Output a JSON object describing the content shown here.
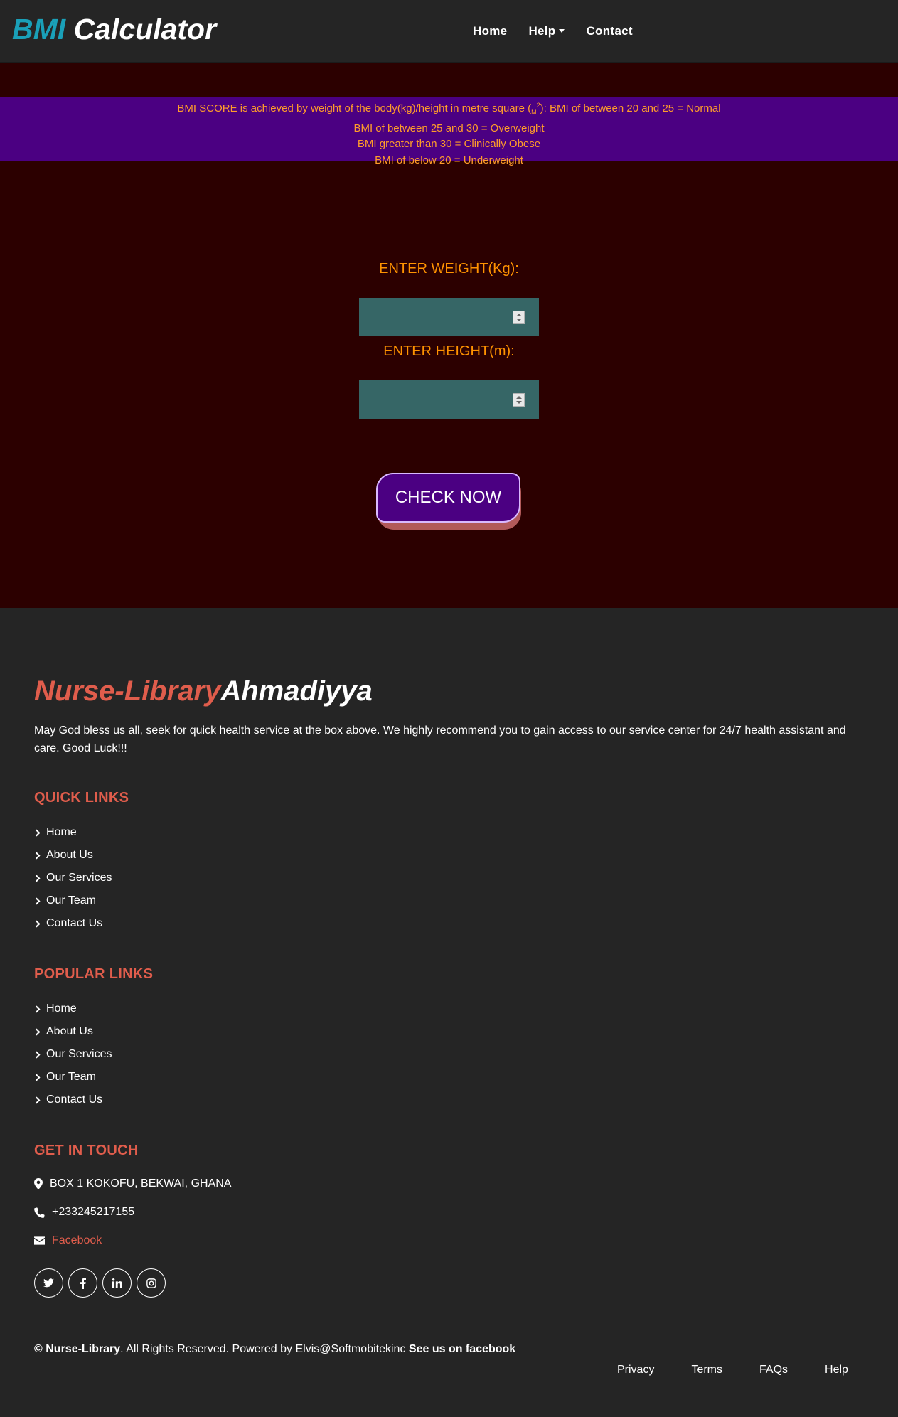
{
  "nav": {
    "brand_part1": "BMI",
    "brand_part2": "Calculator",
    "links": [
      {
        "label": "Home"
      },
      {
        "label": "Help"
      },
      {
        "label": "Contact"
      }
    ]
  },
  "info": {
    "line1_a": "BMI SCORE is achieved by weight of the body(kg)/height in metre square (",
    "line1_m": "M",
    "line1_exp": "2",
    "line1_b": "): BMI of between 20 and 25 = Normal",
    "line2": "BMI of between 25 and 30 = Overweight",
    "line3": "BMI greater than 30 = Clinically Obese",
    "line4": "BMI of below 20 = Underweight"
  },
  "form": {
    "weight_label": "ENTER WEIGHT(Kg):",
    "weight_value": "",
    "height_label": "ENTER HEIGHT(m):",
    "height_value": "",
    "submit_label": "CHECK NOW"
  },
  "footer": {
    "brand_part1": "Nurse-Library",
    "brand_part2": "Ahmadiyya",
    "description": "May God bless us all, seek for quick health service at the box above. We highly recommend you to gain access to our service center for 24/7 health assistant and care. Good Luck!!!",
    "quick_links_title": "QUICK LINKS",
    "quick_links": [
      "Home",
      "About Us",
      "Our Services",
      "Our Team",
      "Contact Us"
    ],
    "popular_links_title": "POPULAR LINKS",
    "popular_links": [
      "Home",
      "About Us",
      "Our Services",
      "Our Team",
      "Contact Us"
    ],
    "touch_title": "GET IN TOUCH",
    "address": "BOX 1 KOKOFU, BEKWAI, GHANA",
    "phone": "+233245217155",
    "email_link": "Facebook",
    "social": [
      {
        "icon": "twitter-icon",
        "glyph": "🐦"
      },
      {
        "icon": "facebook-icon",
        "glyph": "f"
      },
      {
        "icon": "linkedin-icon",
        "glyph": "in"
      },
      {
        "icon": "instagram-icon",
        "glyph": "◎"
      }
    ],
    "copyright_symbol_name": "© Nurse-Library",
    "copyright_text": ". All Rights Reserved. Powered by Elvis@Softmobitekinc ",
    "copyright_link": "See us on facebook",
    "bottom_links": [
      "Privacy",
      "Terms",
      "FAQs",
      "Help"
    ]
  },
  "colors": {
    "accent_cyan": "#1aa0b8",
    "accent_red": "#e05d4c",
    "main_bg": "#2c0000",
    "info_bg": "#4b0082",
    "info_text": "#ff9c2a",
    "input_bg": "#366666"
  }
}
